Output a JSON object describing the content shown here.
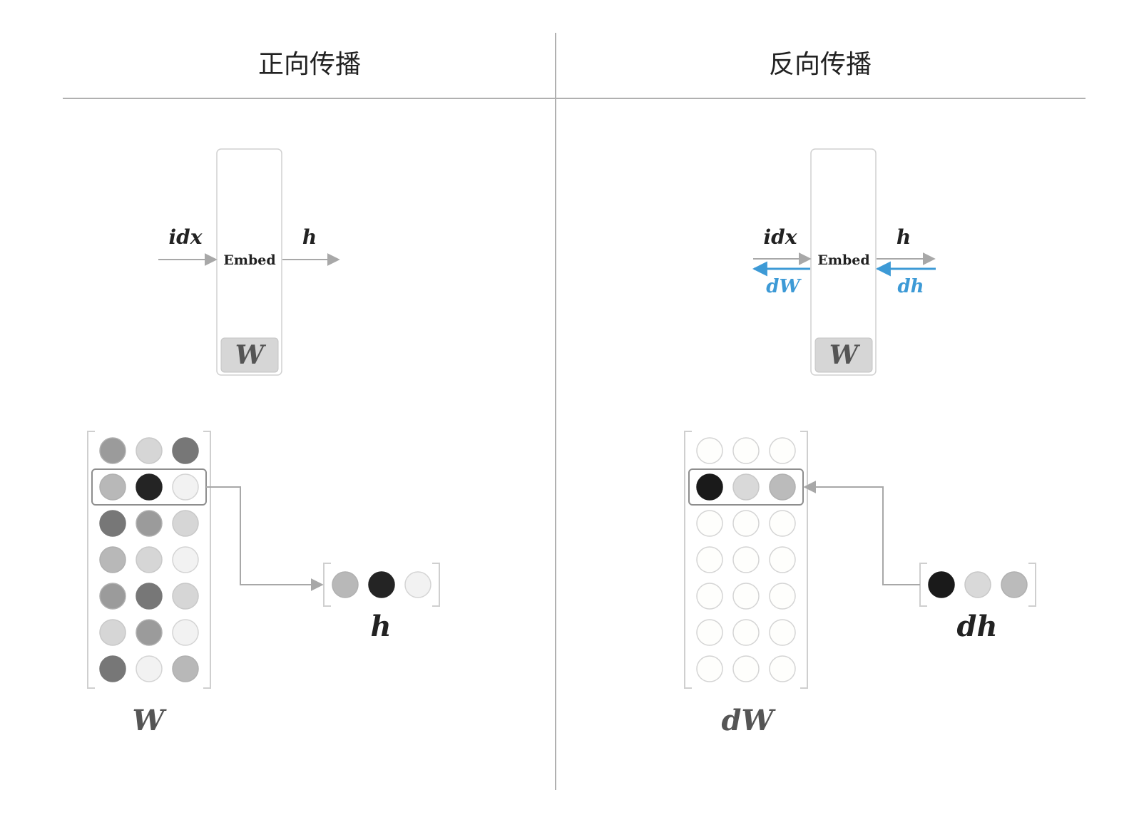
{
  "panels": [
    {
      "id": "forward",
      "title": "正向传播",
      "node": {
        "label": "Embed",
        "param": "W"
      },
      "input_label": "idx",
      "output_label": "h",
      "grad_labels": null,
      "matrix": {
        "label": "W",
        "rows": [
          [
            "#9b9b9b",
            "#d6d6d6",
            "#777777"
          ],
          [
            "#b8b8b8",
            "#242424",
            "#f2f2f2"
          ],
          [
            "#777777",
            "#9b9b9b",
            "#d6d6d6"
          ],
          [
            "#b8b8b8",
            "#d6d6d6",
            "#f2f2f2"
          ],
          [
            "#9b9b9b",
            "#777777",
            "#d6d6d6"
          ],
          [
            "#d6d6d6",
            "#9b9b9b",
            "#f2f2f2"
          ],
          [
            "#777777",
            "#f2f2f2",
            "#b8b8b8"
          ]
        ],
        "selected_row": 1
      },
      "vector": {
        "label": "h",
        "values": [
          "#b8b8b8",
          "#242424",
          "#f2f2f2"
        ]
      },
      "flow": "matrix-to-vector"
    },
    {
      "id": "backward",
      "title": "反向传播",
      "node": {
        "label": "Embed",
        "param": "W"
      },
      "input_label": "idx",
      "output_label": "h",
      "grad_labels": {
        "left": "dW",
        "right": "dh"
      },
      "matrix": {
        "label": "dW",
        "rows": [
          [
            "#fefefc",
            "#fefefc",
            "#fefefc"
          ],
          [
            "#1a1a1a",
            "#d9d9d9",
            "#bbbbbb"
          ],
          [
            "#fefefc",
            "#fefefc",
            "#fefefc"
          ],
          [
            "#fefefc",
            "#fefefc",
            "#fefefc"
          ],
          [
            "#fefefc",
            "#fefefc",
            "#fefefc"
          ],
          [
            "#fefefc",
            "#fefefc",
            "#fefefc"
          ],
          [
            "#fefefc",
            "#fefefc",
            "#fefefc"
          ]
        ],
        "selected_row": 1
      },
      "vector": {
        "label": "dh",
        "values": [
          "#1a1a1a",
          "#d9d9d9",
          "#bbbbbb"
        ]
      },
      "flow": "vector-to-matrix"
    }
  ],
  "colors": {
    "gradient": "#3d9ad6",
    "line": "#a8a8a8",
    "bracket": "#cfcfcf",
    "text": "#222222",
    "label_gray": "#555555"
  }
}
